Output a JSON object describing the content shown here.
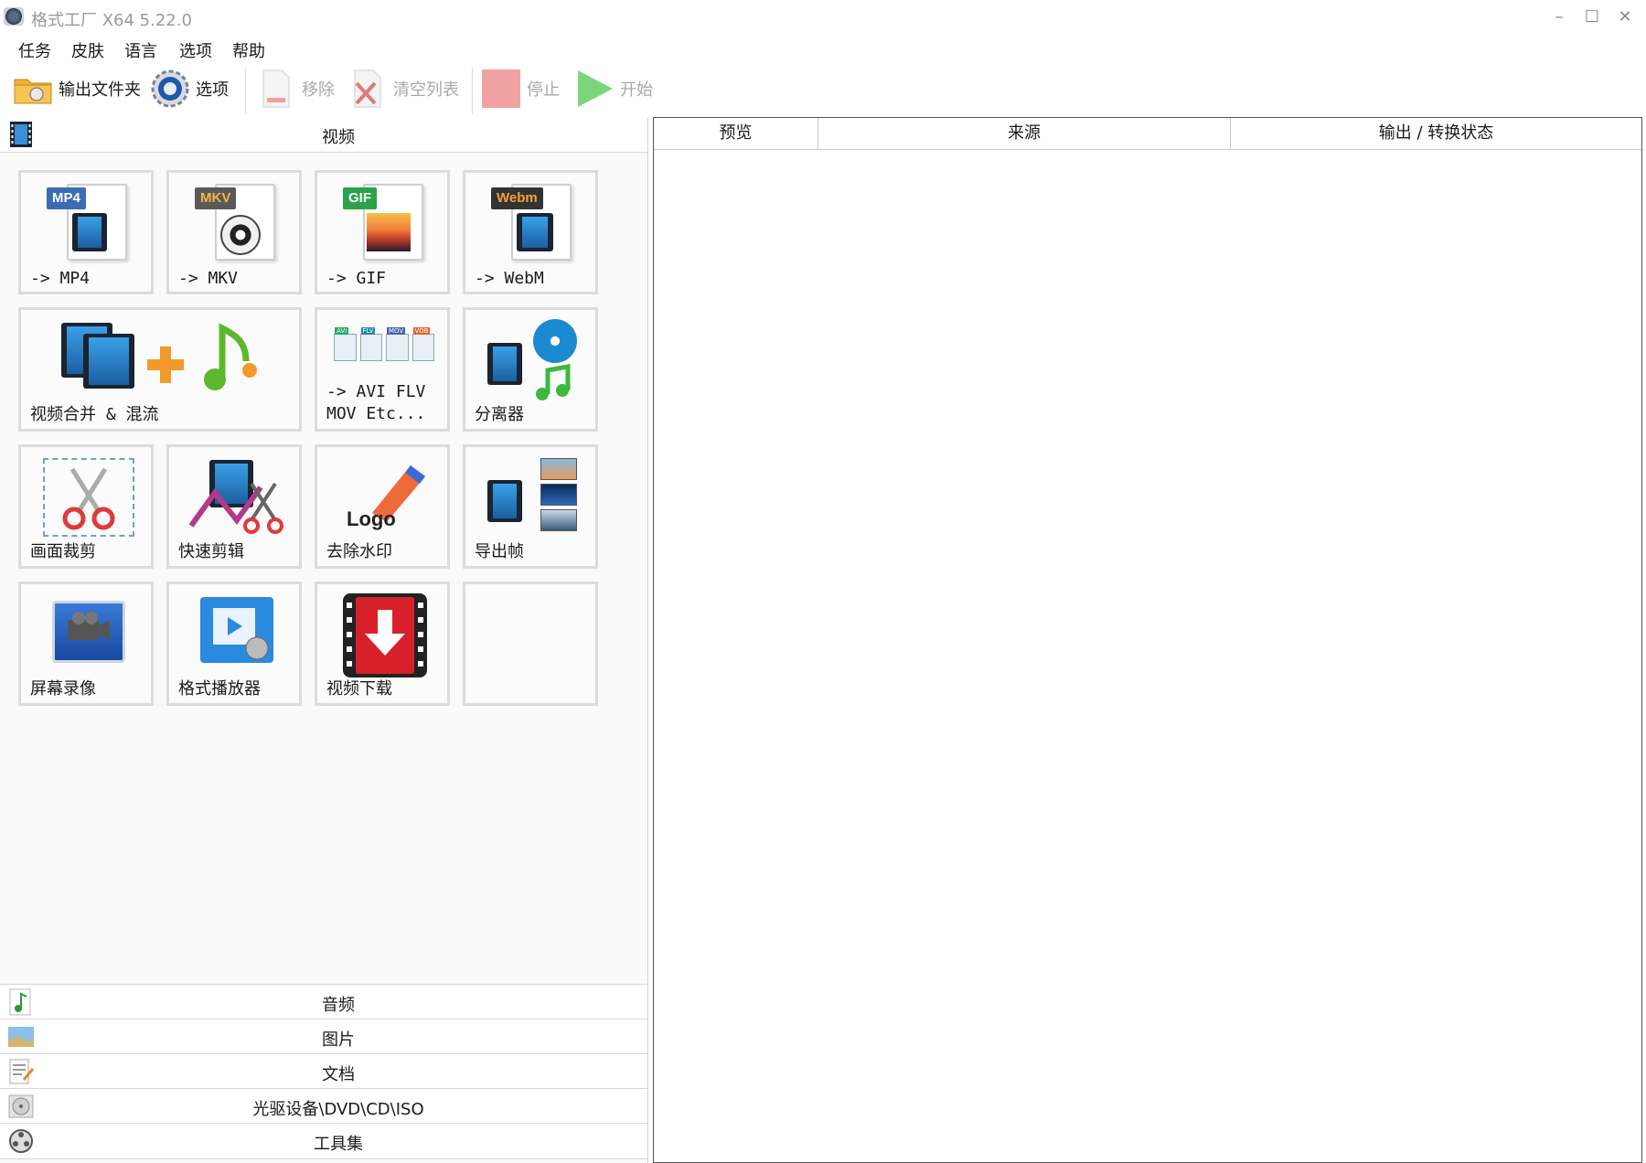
{
  "window": {
    "title": "格式工厂 X64 5.22.0",
    "minimize": "–",
    "maximize": "☐",
    "close": "✕"
  },
  "menu": [
    "任务",
    "皮肤",
    "语言",
    "选项",
    "帮助"
  ],
  "toolbar": {
    "output_folder": "输出文件夹",
    "options": "选项",
    "remove": "移除",
    "clear_list": "清空列表",
    "stop": "停止",
    "start": "开始"
  },
  "categories": {
    "video": "视频",
    "audio": "音频",
    "image": "图片",
    "document": "文档",
    "rom": "光驱设备\\DVD\\CD\\ISO",
    "tools": "工具集"
  },
  "video_tiles": {
    "mp4": {
      "label": "-> MP4",
      "badge": "MP4"
    },
    "mkv": {
      "label": "-> MKV",
      "badge": "MKV"
    },
    "gif": {
      "label": "-> GIF",
      "badge": "GIF"
    },
    "webm": {
      "label": "-> WebM",
      "badge": "Webm"
    },
    "merge": {
      "label": "视频合并 & 混流"
    },
    "other": {
      "label": "-> AVI FLV MOV Etc...",
      "formats": [
        "AVI",
        "FLV",
        "MOV",
        "VOB"
      ]
    },
    "splitter": {
      "label": "分离器"
    },
    "crop": {
      "label": "画面裁剪"
    },
    "quick_cut": {
      "label": "快速剪辑"
    },
    "remove_logo": {
      "label": "去除水印",
      "icon_text": "Logo"
    },
    "export_frames": {
      "label": "导出帧"
    },
    "screen_record": {
      "label": "屏幕录像"
    },
    "player": {
      "label": "格式播放器"
    },
    "download": {
      "label": "视频下载"
    }
  },
  "task_table": {
    "columns": [
      "预览",
      "来源",
      "输出 / 转换状态"
    ]
  },
  "colors": {
    "mp4": "#3b6cb4",
    "mkv": "#5a5a5a",
    "gif": "#2aa34a",
    "webm": "#333333",
    "start": "#3cbf3c",
    "stop": "#e88a8a"
  }
}
